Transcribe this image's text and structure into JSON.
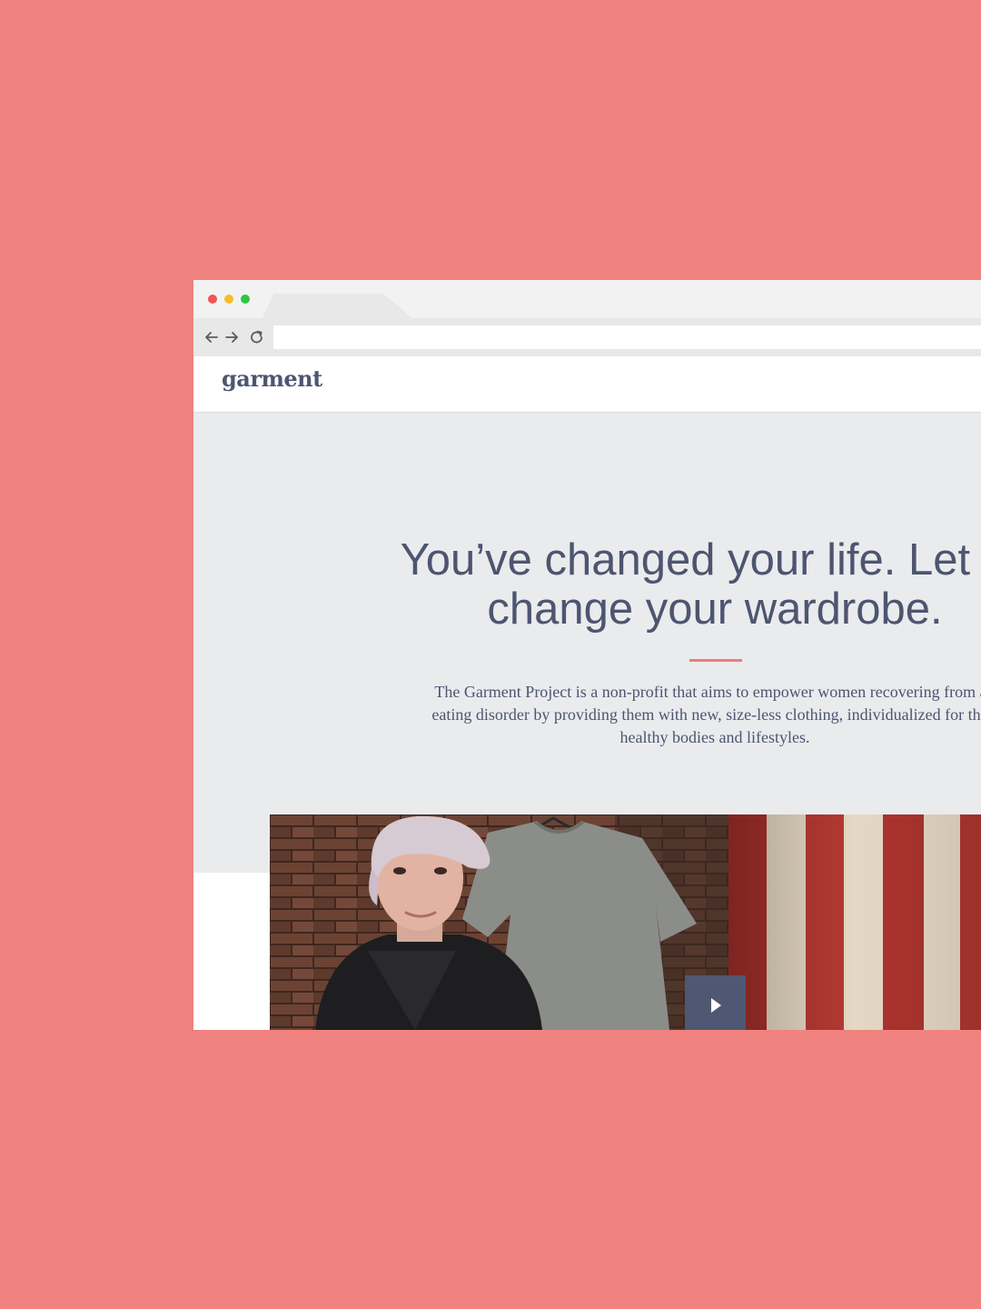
{
  "browser": {
    "window_controls": [
      "close",
      "minimize",
      "maximize"
    ],
    "nav_icons": [
      "back-arrow-icon",
      "forward-arrow-icon",
      "reload-icon"
    ],
    "address_value": ""
  },
  "site": {
    "logo": "garment"
  },
  "hero": {
    "title": "You’ve changed your life. Let us\nchange your wardrobe.",
    "description": "The Garment Project is a non-profit that aims to empower women recovering from an\neating disorder by providing them with new, size-less clothing, individualized for their\nhealthy bodies and lifestyles."
  },
  "video": {
    "play_icon": "play-icon"
  },
  "colors": {
    "background": "#f08280",
    "accent": "#ee7c79",
    "text": "#4d5570",
    "hero_background": "#eaebed",
    "play_button": "#4f5872"
  }
}
